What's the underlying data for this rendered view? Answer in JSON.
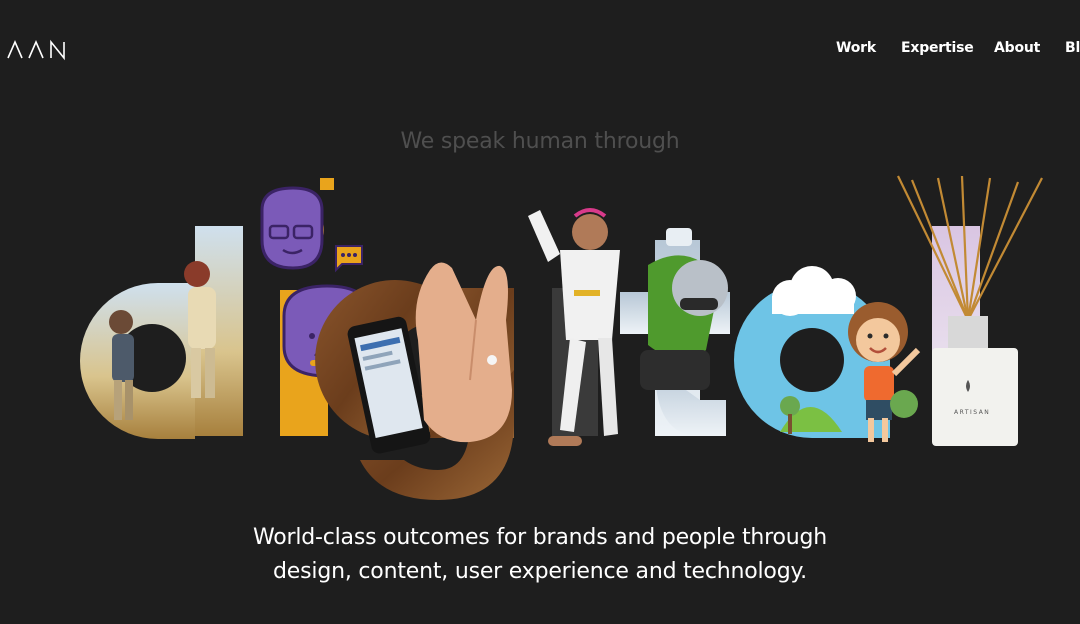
{
  "header": {
    "logo_text": "AAN",
    "nav": [
      {
        "label": "Work"
      },
      {
        "label": "Expertise"
      },
      {
        "label": "About"
      },
      {
        "label": "Blo"
      }
    ]
  },
  "hero": {
    "kicker": "We speak human through",
    "word": "digital",
    "product_label": "ARTISAN",
    "tagline_line1": "World-class outcomes for brands and people through",
    "tagline_line2": "design, content, user experience and technology."
  },
  "colors": {
    "background": "#1e1e1e",
    "kicker": "#4f4f4f",
    "accent_purple": "#7b5ab8",
    "accent_yellow": "#e9a41c"
  }
}
